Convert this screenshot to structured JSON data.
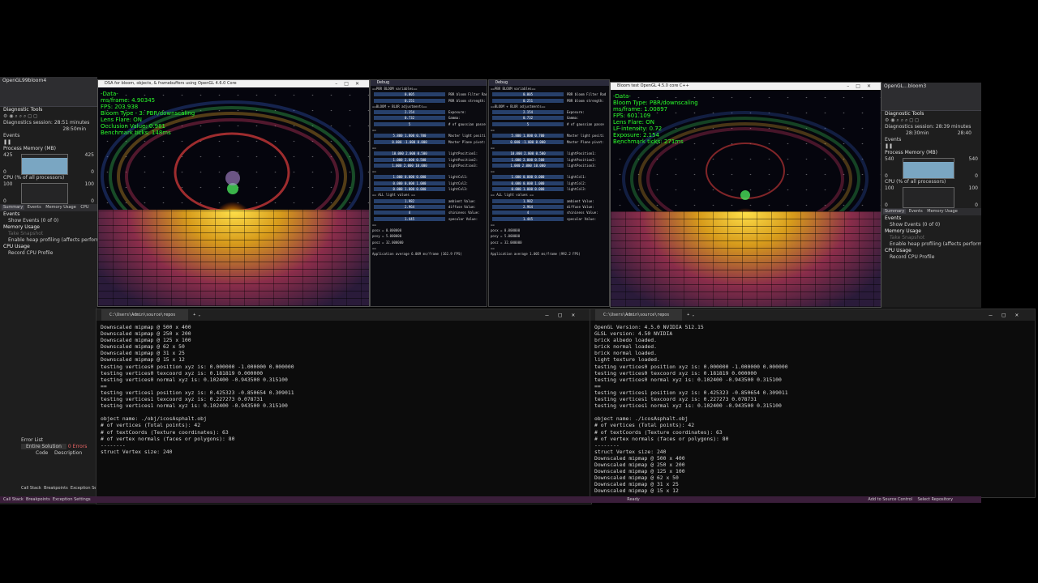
{
  "left_vs": {
    "title": "OpenGL99bloom4",
    "diag_title": "Diagnostic Tools",
    "session": "Diagnostics session: 28:51 minutes",
    "time_label": "28:50min",
    "events_label": "Events",
    "process_memory_label": "Process Memory (MB)",
    "mem_max": "425",
    "mem_min": "0",
    "cpu_label": "CPU (% of all processors)",
    "cpu_max": "100",
    "cpu_min": "0",
    "tabs": [
      "Summary",
      "Events",
      "Memory Usage",
      "CPU"
    ],
    "events_section": "Events",
    "show_events": "Show Events (0 of 0)",
    "memory_usage": "Memory Usage",
    "take_snapshot": "Take Snapshot",
    "heap_profiling": "Enable heap profiling (affects performance)",
    "cpu_usage": "CPU Usage",
    "record_cpu": "Record CPU Profile",
    "error_list": "Error List",
    "entire_solution": "Entire Solution",
    "errors": "0 Errors",
    "code_col": "Code",
    "desc_col": "Description",
    "bottom_tabs": [
      "Call Stack",
      "Breakpoints",
      "Exception Settings"
    ]
  },
  "right_vs": {
    "title": "OpenGL...bloom3",
    "diag_title": "Diagnostic Tools",
    "session": "Diagnostics session: 28:39 minutes",
    "time_label": "28:30min",
    "time_label2": "28:40",
    "events_label": "Events",
    "process_memory_label": "Process Memory (MB)",
    "mem_max": "540",
    "mem_min": "0",
    "cpu_label": "CPU (% of all processors)",
    "cpu_max": "100",
    "cpu_min": "0",
    "tabs": [
      "Summary",
      "Events",
      "Memory Usage"
    ],
    "events_section": "Events",
    "show_events": "Show Events (0 of 0)",
    "memory_usage": "Memory Usage",
    "take_snapshot": "Take Snapshot",
    "heap_profiling": "Enable heap profiling (affects perform",
    "cpu_usage": "CPU Usage",
    "record_cpu": "Record CPU Profile"
  },
  "gl_left": {
    "title": "DSA for bloom, objects, & framebuffers using OpenGL 4.6.0 Core",
    "overlay": [
      "-Data-",
      "ms/frame: 4.90345",
      "FPS: 203.938",
      "Bloom Type - 3: PBR/downscaling",
      "Lens Flare: ON",
      "Occlusion Value: 0.981",
      "Benchmark ticks: 148ms"
    ]
  },
  "gl_right": {
    "title": "Bloom test OpenGL 4.5.0 core C++",
    "overlay": [
      "-Data-",
      "Bloom Type: PBR/downscaling",
      "ms/frame: 1.00897",
      "FPS: 601.109",
      "Lens Flare: ON",
      "LF intensity: 0.72",
      "Exposure: 2.154",
      "Benchmark ticks: 271ms"
    ]
  },
  "debug_left": {
    "title": "Debug",
    "rows": [
      {
        "type": "hdr",
        "text": "==PBR BLOOM variables=="
      },
      {
        "type": "slider",
        "value": "0.005",
        "label": "PBR bloom Filter Rad"
      },
      {
        "type": "slider",
        "value": "0.251",
        "label": "PBR bloom strength:"
      },
      {
        "type": "hdr",
        "text": "==BLOOM + BLUR adjustments=="
      },
      {
        "type": "slider",
        "value": "2.154",
        "label": "Exposure:"
      },
      {
        "type": "slider",
        "value": "0.732",
        "label": "Gamma:"
      },
      {
        "type": "slider",
        "value": "5",
        "label": "# of gaussian passe"
      },
      {
        "type": "hdr",
        "text": "=="
      },
      {
        "type": "slider",
        "value": "5.800  1.800  0.700",
        "label": "Master light positi"
      },
      {
        "type": "slider",
        "value": "0.000  -1.000  0.000",
        "label": "Master Plane pivot:"
      },
      {
        "type": "hdr",
        "text": "=="
      },
      {
        "type": "slider",
        "value": "10.000  2.000  0.500",
        "label": "lightPosition1:"
      },
      {
        "type": "slider",
        "value": "1.000  2.000  0.500",
        "label": "lightPosition2:"
      },
      {
        "type": "slider",
        "value": "1.000  2.000  10.000",
        "label": "lightPosition3:"
      },
      {
        "type": "hdr",
        "text": "=="
      },
      {
        "type": "slider",
        "value": "1.000  0.000  0.000",
        "label": "lightCol1:"
      },
      {
        "type": "slider",
        "value": "0.000  0.000  1.000",
        "label": "lightCol2:"
      },
      {
        "type": "slider",
        "value": "0.000  1.000  0.000",
        "label": "lightCol3:"
      },
      {
        "type": "hdr",
        "text": "== ALL light values =="
      },
      {
        "type": "slider",
        "value": "1.982",
        "label": "ambient Value:"
      },
      {
        "type": "slider",
        "value": "2.964",
        "label": "diffuse Value:"
      },
      {
        "type": "slider",
        "value": "4",
        "label": "shininess Value:"
      },
      {
        "type": "slider",
        "value": "1.445",
        "label": "specular Value:"
      },
      {
        "type": "hdr",
        "text": "=="
      },
      {
        "type": "hdr",
        "text": "posx = 0.000000"
      },
      {
        "type": "hdr",
        "text": "posy = 5.000000"
      },
      {
        "type": "hdr",
        "text": "posz = 32.000000"
      },
      {
        "type": "hdr",
        "text": "=="
      },
      {
        "type": "hdr",
        "text": "Application average 6.009 ms/frame (162.9 FPS)"
      }
    ]
  },
  "debug_right": {
    "title": "Debug",
    "rows": [
      {
        "type": "hdr",
        "text": "==PBR BLOOM variables=="
      },
      {
        "type": "slider",
        "value": "0.005",
        "label": "PBR bloom Filter Rad"
      },
      {
        "type": "slider",
        "value": "0.251",
        "label": "PBR bloom strength:"
      },
      {
        "type": "hdr",
        "text": "==BLOOM + BLUR adjustments=="
      },
      {
        "type": "slider",
        "value": "2.154",
        "label": "Exposure:"
      },
      {
        "type": "slider",
        "value": "0.732",
        "label": "Gamma:"
      },
      {
        "type": "slider",
        "value": "5",
        "label": "# of gaussian passe"
      },
      {
        "type": "hdr",
        "text": "=="
      },
      {
        "type": "slider",
        "value": "5.800  1.800  0.700",
        "label": "Master light positi"
      },
      {
        "type": "slider",
        "value": "0.000  -1.000  0.000",
        "label": "Master Plane pivot:"
      },
      {
        "type": "hdr",
        "text": "=="
      },
      {
        "type": "slider",
        "value": "10.000  2.000  0.500",
        "label": "lightPosition1:"
      },
      {
        "type": "slider",
        "value": "1.000  2.000  0.500",
        "label": "lightPosition2:"
      },
      {
        "type": "slider",
        "value": "1.000  2.000  10.000",
        "label": "lightPosition3:"
      },
      {
        "type": "hdr",
        "text": "=="
      },
      {
        "type": "slider",
        "value": "1.000  0.000  0.000",
        "label": "lightCol1:"
      },
      {
        "type": "slider",
        "value": "0.000  0.000  1.000",
        "label": "lightCol2:"
      },
      {
        "type": "slider",
        "value": "0.000  1.000  0.000",
        "label": "lightCol3:"
      },
      {
        "type": "hdr",
        "text": "== ALL light values =="
      },
      {
        "type": "slider",
        "value": "1.982",
        "label": "ambient Value:"
      },
      {
        "type": "slider",
        "value": "2.964",
        "label": "diffuse Value:"
      },
      {
        "type": "slider",
        "value": "4",
        "label": "shininess Value:"
      },
      {
        "type": "slider",
        "value": "1.445",
        "label": "specular Value:"
      },
      {
        "type": "hdr",
        "text": "=="
      },
      {
        "type": "hdr",
        "text": "posx = 0.000000"
      },
      {
        "type": "hdr",
        "text": "posy = 5.000000"
      },
      {
        "type": "hdr",
        "text": "posz = 32.000000"
      },
      {
        "type": "hdr",
        "text": "=="
      },
      {
        "type": "hdr",
        "text": "Application average 1.005 ms/frame (992.2 FPS)"
      }
    ]
  },
  "term_left": {
    "tab": "C:\\Users\\Admin\\source\\repos",
    "lines": [
      "Downscaled mipmap @ 500 x 400",
      "Downscaled mipmap @ 250 x 200",
      "Downscaled mipmap @ 125 x 100",
      "Downscaled mipmap @ 62 x 50",
      "Downscaled mipmap @ 31 x 25",
      "Downscaled mipmap @ 15 x 12",
      "testing vertices0 position xyz is: 0.000000 -1.000000 0.000000",
      "testing vertices0 texcoord xyz is: 0.181819 0.000000",
      "testing vertices0 normal xyz is: 0.102400 -0.943500 0.315100",
      "==",
      "testing vertices1 position xyz is: 0.425323 -0.850654 0.309011",
      "testing vertices1 texcoord xyz is: 0.227273 0.078731",
      "testing vertices1 normal xyz is: 0.102400 -0.943500 0.315100",
      "",
      "object name: ./obj/icosAsphalt.obj",
      "# of vertices (Total points): 42",
      "# of textCoords (Texture coordinates): 63",
      "# of vertex normals (faces or polygons): 80",
      "--------",
      "struct Vertex size: 240"
    ]
  },
  "term_right": {
    "tab": "C:\\Users\\Admin\\source\\repos",
    "lines": [
      "OpenGL Version: 4.5.0 NVIDIA 512.15",
      "GLSL version: 4.50 NVIDIA",
      "brick albedo loaded.",
      "brick normal loaded.",
      "brick normal loaded.",
      "light texture loaded.",
      "testing vertices0 position xyz is: 0.000000 -1.000000 0.000000",
      "testing vertices0 texcoord xyz is: 0.181819 0.000000",
      "testing vertices0 normal xyz is: 0.102400 -0.943500 0.315100",
      "==",
      "testing vertices1 position xyz is: 0.425323 -0.850654 0.309011",
      "testing vertices1 texcoord xyz is: 0.227273 0.078731",
      "testing vertices1 normal xyz is: 0.102400 -0.943500 0.315100",
      "",
      "object name: ./icosAsphalt.obj",
      "# of vertices (Total points): 42",
      "# of textCoords (Texture coordinates): 63",
      "# of vertex normals (faces or polygons): 80",
      "--------",
      "struct Vertex size: 240",
      "Downscaled mipmap @ 500 x 400",
      "Downscaled mipmap @ 250 x 200",
      "Downscaled mipmap @ 125 x 100",
      "Downscaled mipmap @ 62 x 50",
      "Downscaled mipmap @ 31 x 25",
      "Downscaled mipmap @ 15 x 12"
    ]
  },
  "taskbar": {
    "ready": "Ready",
    "add_source": "Add to Source Control",
    "select_repo": "Select Repository"
  }
}
